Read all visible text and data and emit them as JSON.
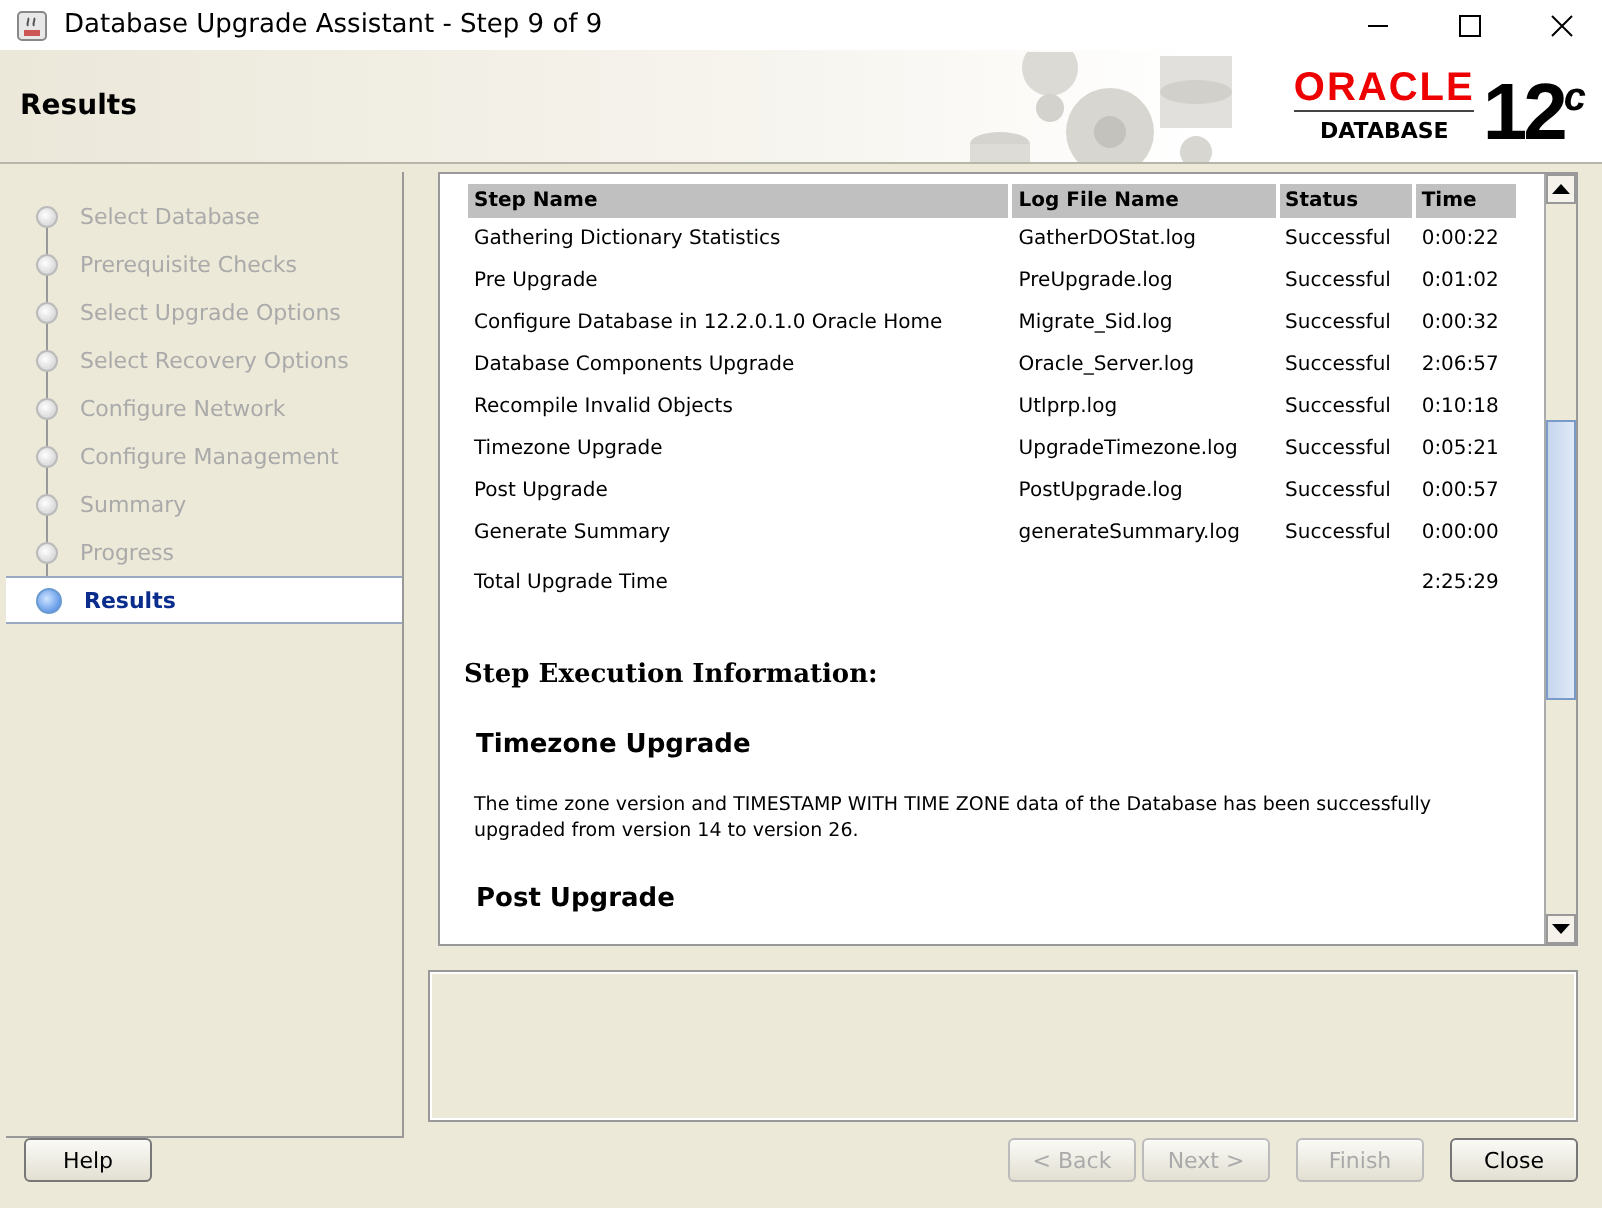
{
  "window": {
    "title": "Database Upgrade Assistant - Step 9 of 9"
  },
  "header": {
    "title": "Results",
    "logo": {
      "brand": "ORACLE",
      "product": "DATABASE",
      "version": "12",
      "version_sup": "c"
    }
  },
  "steps": [
    {
      "label": "Select Database",
      "selected": false
    },
    {
      "label": "Prerequisite Checks",
      "selected": false
    },
    {
      "label": "Select Upgrade Options",
      "selected": false
    },
    {
      "label": "Select Recovery Options",
      "selected": false
    },
    {
      "label": "Configure Network",
      "selected": false
    },
    {
      "label": "Configure Management",
      "selected": false
    },
    {
      "label": "Summary",
      "selected": false
    },
    {
      "label": "Progress",
      "selected": false
    },
    {
      "label": "Results",
      "selected": true
    }
  ],
  "table": {
    "columns": [
      "Step Name",
      "Log File Name",
      "Status",
      "Time"
    ],
    "rows": [
      [
        "Gathering Dictionary Statistics",
        "GatherDOStat.log",
        "Successful",
        "0:00:22"
      ],
      [
        "Pre Upgrade",
        "PreUpgrade.log",
        "Successful",
        "0:01:02"
      ],
      [
        "Configure Database in 12.2.0.1.0 Oracle Home",
        "Migrate_Sid.log",
        "Successful",
        "0:00:32"
      ],
      [
        "Database Components Upgrade",
        "Oracle_Server.log",
        "Successful",
        "2:06:57"
      ],
      [
        "Recompile Invalid Objects",
        "Utlprp.log",
        "Successful",
        "0:10:18"
      ],
      [
        "Timezone Upgrade",
        "UpgradeTimezone.log",
        "Successful",
        "0:05:21"
      ],
      [
        "Post Upgrade",
        "PostUpgrade.log",
        "Successful",
        "0:00:57"
      ],
      [
        "Generate Summary",
        "generateSummary.log",
        "Successful",
        "0:00:00"
      ]
    ],
    "total": {
      "label": "Total Upgrade Time",
      "time": "2:25:29"
    }
  },
  "execution": {
    "heading": "Step Execution Information:",
    "sections": [
      {
        "title": "Timezone Upgrade",
        "text": "The time zone version and TIMESTAMP WITH TIME ZONE data of the Database has been successfully upgraded from version 14 to version 26."
      },
      {
        "title": "Post Upgrade"
      }
    ]
  },
  "buttons": [
    {
      "label": "Help",
      "disabled": false
    },
    {
      "label": "< Back",
      "disabled": true
    },
    {
      "label": "Next >",
      "disabled": true
    },
    {
      "label": "Finish",
      "disabled": true
    },
    {
      "label": "Close",
      "disabled": false
    }
  ]
}
